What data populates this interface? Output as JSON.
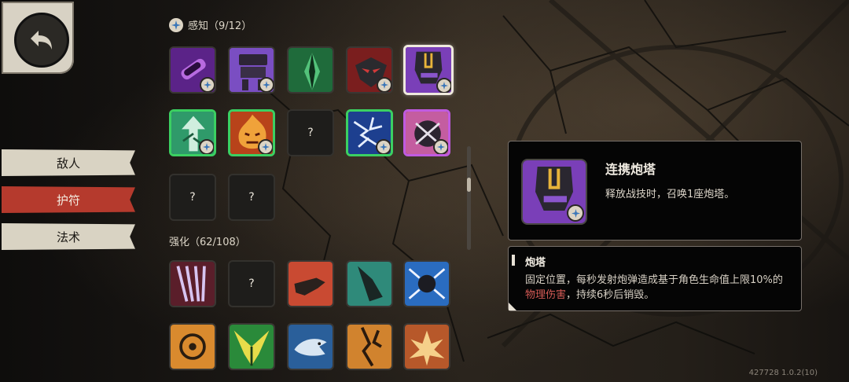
{
  "nav": {
    "tabs": [
      {
        "label": "敌人",
        "active": false
      },
      {
        "label": "护符",
        "active": true
      },
      {
        "label": "法术",
        "active": false
      }
    ]
  },
  "sections": {
    "perception": {
      "label": "感知（9/12）"
    },
    "enhance": {
      "label": "强化（62/108）"
    }
  },
  "grid": {
    "unknown_label": "?",
    "perception_tiles": [
      {
        "icon": "purple-vial-icon"
      },
      {
        "icon": "purple-robot-icon"
      },
      {
        "icon": "green-crystal-icon"
      },
      {
        "icon": "red-mask-icon"
      },
      {
        "icon": "linked-turret-icon",
        "selected": true
      },
      {
        "icon": "green-arrow-tree-icon"
      },
      {
        "icon": "fire-face-icon"
      },
      {
        "icon": "unknown-icon"
      },
      {
        "icon": "blue-lightning-icon"
      },
      {
        "icon": "pink-chain-orb-icon"
      },
      {
        "icon": "unknown-icon"
      },
      {
        "icon": "unknown-icon"
      }
    ],
    "enhance_tiles": [
      {
        "icon": "purple-slash-icon"
      },
      {
        "icon": "unknown-icon"
      },
      {
        "icon": "red-hand-icon"
      },
      {
        "icon": "teal-leg-icon"
      },
      {
        "icon": "blue-shock-orb-icon"
      },
      {
        "icon": "orange-gear-icon"
      },
      {
        "icon": "green-leaf-icon"
      },
      {
        "icon": "blue-fish-icon"
      },
      {
        "icon": "orange-crack-icon"
      },
      {
        "icon": "orange-burst-icon"
      }
    ]
  },
  "detail": {
    "title": "连携炮塔",
    "description": "释放战技时，召唤1座炮塔。",
    "icon": "linked-turret-icon"
  },
  "tooltip": {
    "title": "炮塔",
    "line1": "固定位置，每秒发射炮弹造成基于角色生命值上限10%的",
    "highlight": "物理伤害",
    "line2_rest": "，持续6秒后销毁。"
  },
  "colors": {
    "accent_red": "#b53a2d",
    "border_green": "#3bd062",
    "border_purple": "#c05be0",
    "highlight": "#d55a55"
  },
  "version": "427728 1.0.2(10)"
}
